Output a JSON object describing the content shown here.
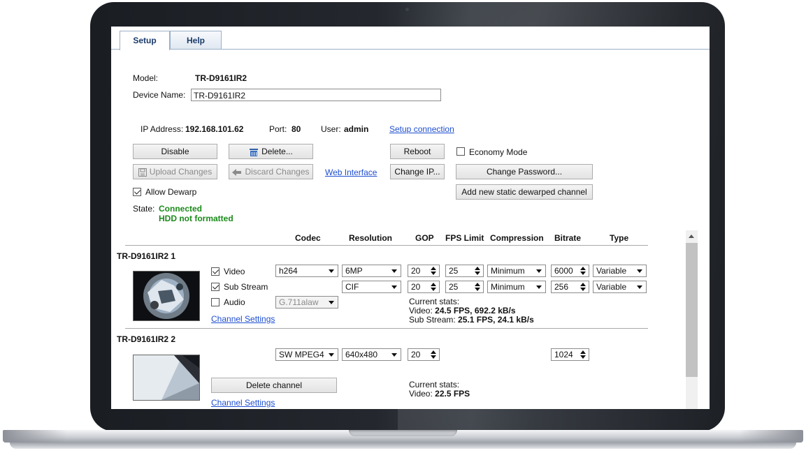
{
  "tabs": {
    "setup": "Setup",
    "help": "Help"
  },
  "device": {
    "model_label": "Model:",
    "model": "TR-D9161IR2",
    "name_label": "Device Name:",
    "name": "TR-D9161IR2",
    "ip_label": "IP Address:",
    "ip": "192.168.101.62",
    "port_label": "Port:",
    "port": "80",
    "user_label": "User:",
    "user": "admin",
    "setup_connection": "Setup connection"
  },
  "buttons": {
    "disable": "Disable",
    "delete": "Delete...",
    "reboot": "Reboot",
    "upload": "Upload Changes",
    "discard": "Discard Changes",
    "web_interface": "Web Interface",
    "change_ip": "Change IP...",
    "change_password": "Change Password...",
    "add_dewarp": "Add new static dewarped channel"
  },
  "options": {
    "economy_mode": "Economy Mode",
    "allow_dewarp": "Allow Dewarp"
  },
  "state": {
    "label": "State:",
    "line1": "Connected",
    "line2": "HDD not formatted"
  },
  "columns": {
    "codec": "Codec",
    "resolution": "Resolution",
    "gop": "GOP",
    "fps": "FPS Limit",
    "compression": "Compression",
    "bitrate": "Bitrate",
    "type": "Type"
  },
  "channels": [
    {
      "title": "TR-D9161IR2 1",
      "video_label": "Video",
      "sub_label": "Sub Stream",
      "audio_label": "Audio",
      "video": {
        "codec": "h264",
        "resolution": "6MP",
        "gop": "20",
        "fps": "25",
        "compression": "Minimum",
        "bitrate": "6000",
        "type": "Variable"
      },
      "sub": {
        "resolution": "CIF",
        "gop": "20",
        "fps": "25",
        "compression": "Minimum",
        "bitrate": "256",
        "type": "Variable"
      },
      "audio_codec": "G.711alaw",
      "stats_title": "Current stats:",
      "stats_video_label": "Video:",
      "stats_video": "24.5 FPS, 692.2 kB/s",
      "stats_sub_label": "Sub Stream:",
      "stats_sub": "25.1 FPS, 24.1 kB/s",
      "settings_link": "Channel Settings"
    },
    {
      "title": "TR-D9161IR2 2",
      "codec": "SW MPEG4",
      "resolution": "640x480",
      "gop": "20",
      "bitrate": "1024",
      "delete_label": "Delete channel",
      "stats_title": "Current stats:",
      "stats_video_label": "Video:",
      "stats_video": "22.5 FPS",
      "settings_link": "Channel Settings"
    }
  ]
}
